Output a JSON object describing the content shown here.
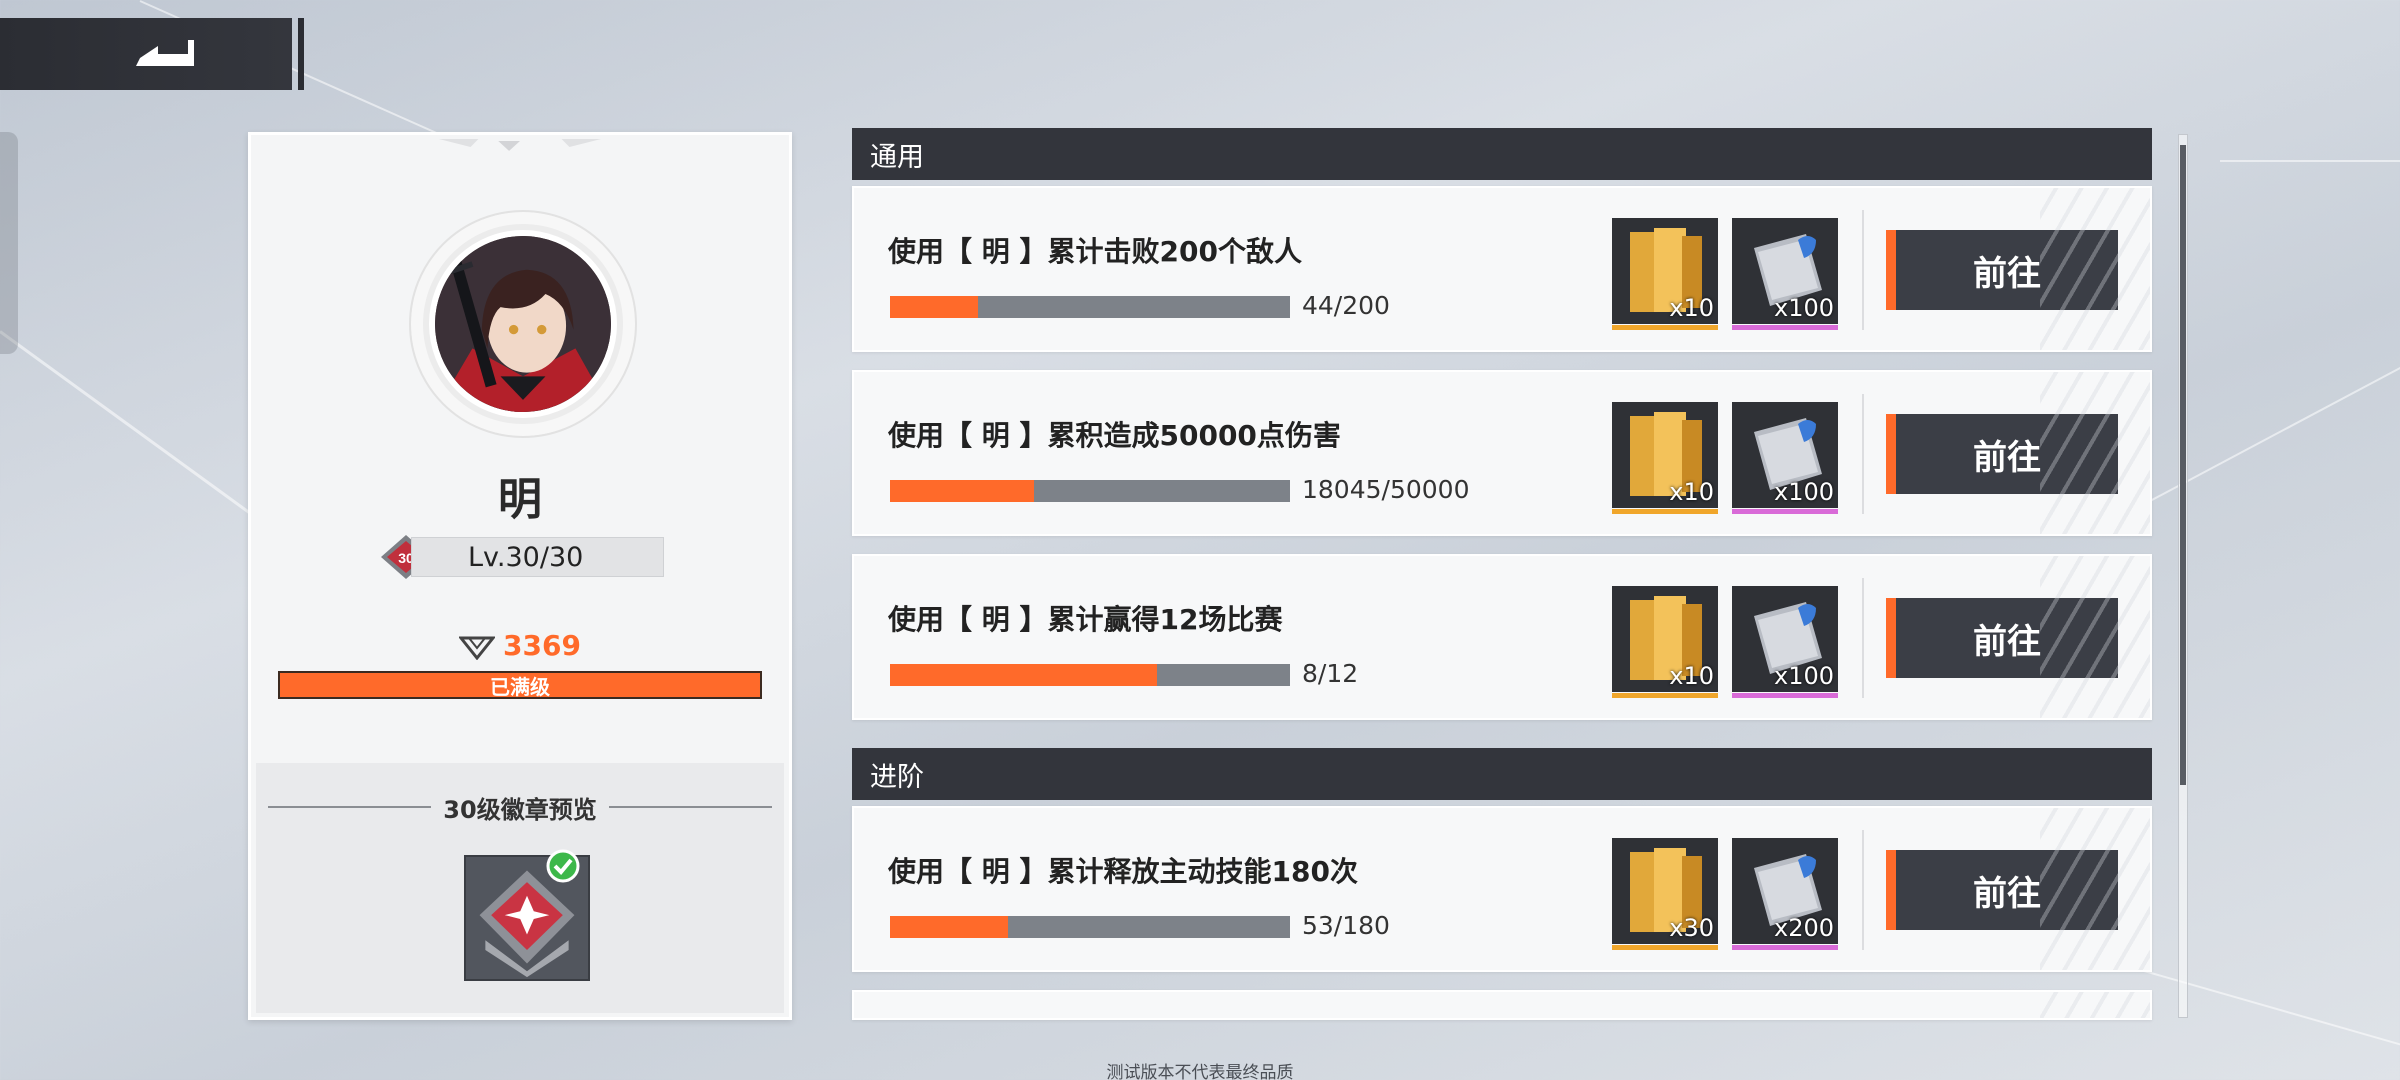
{
  "header": {
    "back_icon": "back-arrow-icon"
  },
  "character": {
    "name": "明",
    "level_text": "Lv.30/30",
    "level_badge_number": "30",
    "exp_value": "3369",
    "max_label": "已满级",
    "preview_title": "30级徽章预览"
  },
  "sections": [
    {
      "title": "通用"
    },
    {
      "title": "进阶"
    }
  ],
  "tasks": [
    {
      "title": "使用【 明 】累计击败200个敌人",
      "progress_text": "44/200",
      "progress": 0.22,
      "reward1_qty": "x10",
      "reward2_qty": "x100",
      "button": "前往"
    },
    {
      "title": "使用【 明 】累积造成50000点伤害",
      "progress_text": "18045/50000",
      "progress": 0.3609,
      "reward1_qty": "x10",
      "reward2_qty": "x100",
      "button": "前往"
    },
    {
      "title": "使用【 明 】累计赢得12场比赛",
      "progress_text": "8/12",
      "progress": 0.6667,
      "reward1_qty": "x10",
      "reward2_qty": "x100",
      "button": "前往"
    },
    {
      "title": "使用【 明 】累计释放主动技能180次",
      "progress_text": "53/180",
      "progress": 0.2944,
      "reward1_qty": "x30",
      "reward2_qty": "x200",
      "button": "前往"
    }
  ],
  "colors": {
    "accent": "#ff6a2a",
    "dark": "#33353c",
    "rarity_gold": "#f0a62b",
    "rarity_purple": "#d96bd8"
  },
  "footer": {
    "watermark": "测试版本不代表最终品质"
  }
}
